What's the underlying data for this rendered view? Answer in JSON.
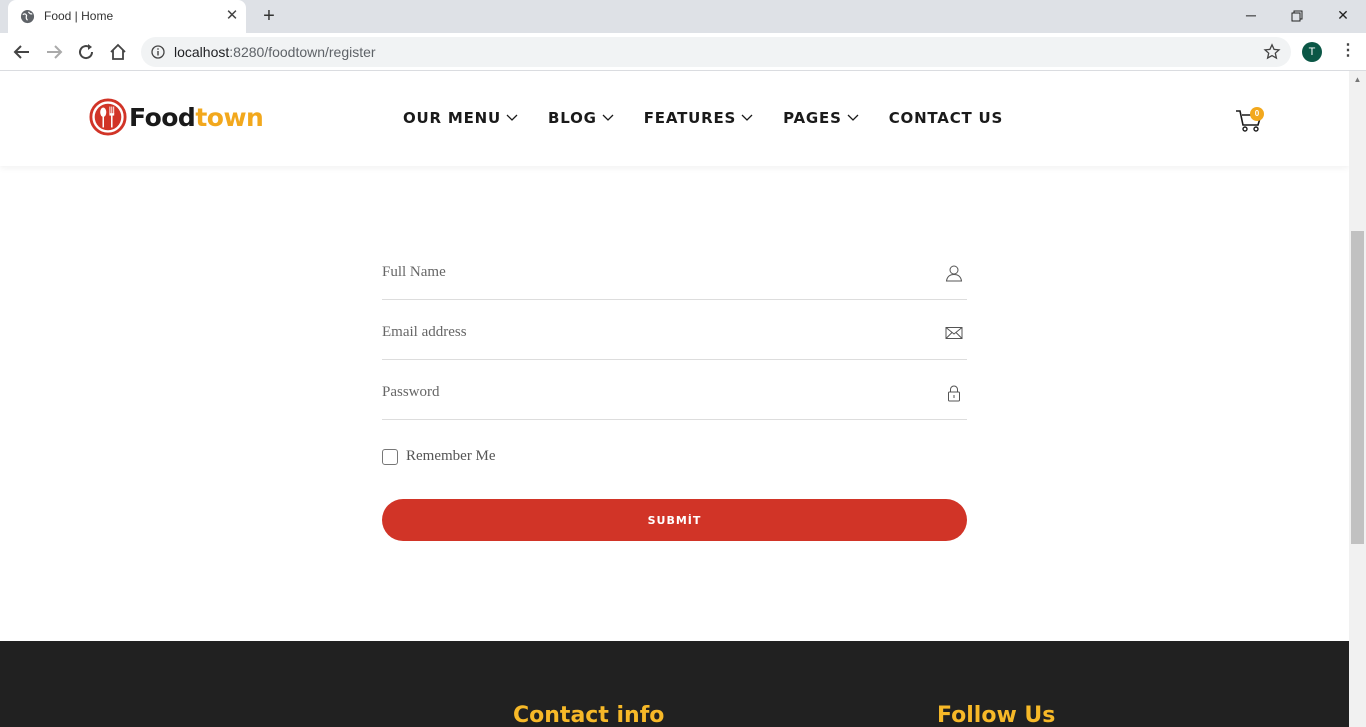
{
  "browser": {
    "tab_title": "Food | Home",
    "url_host": "localhost",
    "url_rest": ":8280/foodtown/register",
    "profile_initial": "T"
  },
  "site": {
    "logo_part1": "Food",
    "logo_part2": "town",
    "nav": [
      "OUR MENU",
      "BLOG",
      "FEATURES",
      "PAGES",
      "CONTACT US"
    ],
    "cart_count": "0"
  },
  "form": {
    "full_name_placeholder": "Full Name",
    "email_placeholder": "Email address",
    "password_placeholder": "Password",
    "remember_label": "Remember Me",
    "submit_label": "SUBMİT"
  },
  "footer": {
    "contact_heading": "Contact info",
    "follow_heading": "Follow Us"
  },
  "colors": {
    "brand_red": "#d13427",
    "brand_yellow": "#f2a81d",
    "footer_bg": "#212121"
  }
}
